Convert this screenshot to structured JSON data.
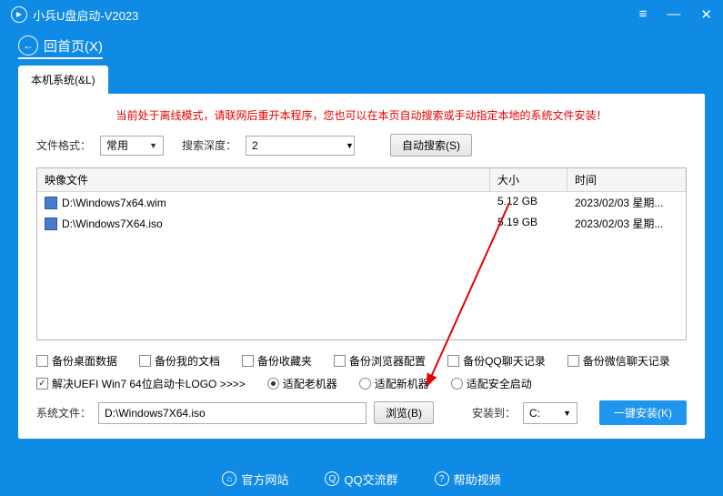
{
  "titlebar": {
    "title": "小兵U盘启动-V2023"
  },
  "nav": {
    "back": "回首页(X)"
  },
  "tab": {
    "local": "本机系统(&L)"
  },
  "offline_msg": "当前处于离线模式，请联网后重开本程序，您也可以在本页自动搜索或手动指定本地的系统文件安装！",
  "filter": {
    "format_label": "文件格式：",
    "format_value": "常用",
    "depth_label": "搜索深度：",
    "depth_value": "2",
    "auto_search": "自动搜索(S)"
  },
  "table": {
    "headers": {
      "file": "映像文件",
      "size": "大小",
      "time": "时间"
    },
    "rows": [
      {
        "file": "D:\\Windows7x64.wim",
        "size": "5.12 GB",
        "time": "2023/02/03 星期..."
      },
      {
        "file": "D:\\Windows7X64.iso",
        "size": "5.19 GB",
        "time": "2023/02/03 星期..."
      }
    ]
  },
  "opts": {
    "backup_desktop": "备份桌面数据",
    "backup_docs": "备份我的文档",
    "backup_fav": "备份收藏夹",
    "backup_browser": "备份浏览器配置",
    "backup_qq": "备份QQ聊天记录",
    "backup_wx": "备份微信聊天记录",
    "uefi_fix": "解决UEFI Win7 64位启动卡LOGO >>>>",
    "radio_old": "适配老机器",
    "radio_new": "适配新机器",
    "radio_secure": "适配安全启动"
  },
  "install": {
    "sysfile_label": "系统文件：",
    "sysfile_value": "D:\\Windows7X64.iso",
    "browse": "浏览(B)",
    "install_to": "安装到：",
    "drive": "C:",
    "onekey": "一键安装(K)"
  },
  "footer": {
    "site": "官方网站",
    "qq": "QQ交流群",
    "help": "帮助视频"
  }
}
